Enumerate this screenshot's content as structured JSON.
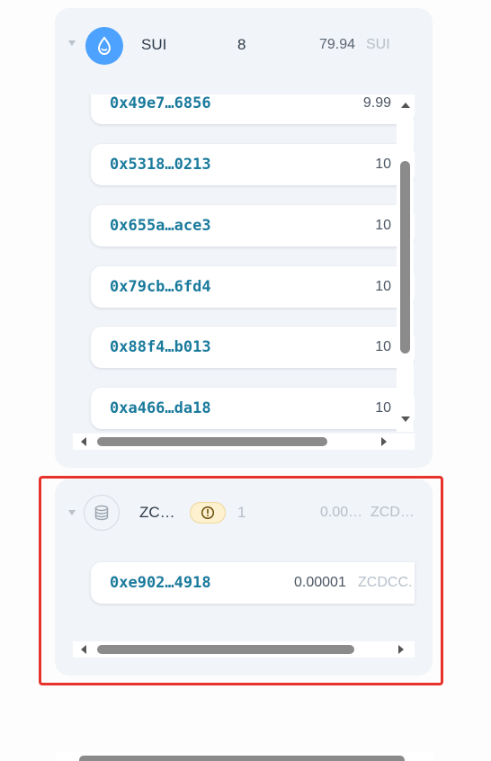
{
  "coins": [
    {
      "name": "SUI",
      "object_count": "8",
      "balance": "79.94",
      "symbol": "SUI",
      "icon": "sui-droplet-icon",
      "icon_color": "#4da2ff",
      "objects": [
        {
          "id": "0x49e7…6856",
          "value": "9.99"
        },
        {
          "id": "0x5318…0213",
          "value": "10"
        },
        {
          "id": "0x655a…ace3",
          "value": "10"
        },
        {
          "id": "0x79cb…6fd4",
          "value": "10"
        },
        {
          "id": "0x88f4…b013",
          "value": "10"
        },
        {
          "id": "0xa466…da18",
          "value": "10"
        }
      ]
    },
    {
      "name": "ZC…",
      "object_count": "1",
      "balance": "0.00…",
      "symbol": "ZCD…",
      "icon": "coin-stack-icon",
      "warning_icon": "warning-icon",
      "objects": [
        {
          "id": "0xe902…4918",
          "value": "0.00001",
          "symbol": "ZCDCC."
        }
      ]
    }
  ],
  "colors": {
    "card_bg": "#f1f4f8",
    "object_id": "#1a7a9c",
    "highlight": "#e8322c",
    "warning_bg": "#fdf1cf"
  }
}
